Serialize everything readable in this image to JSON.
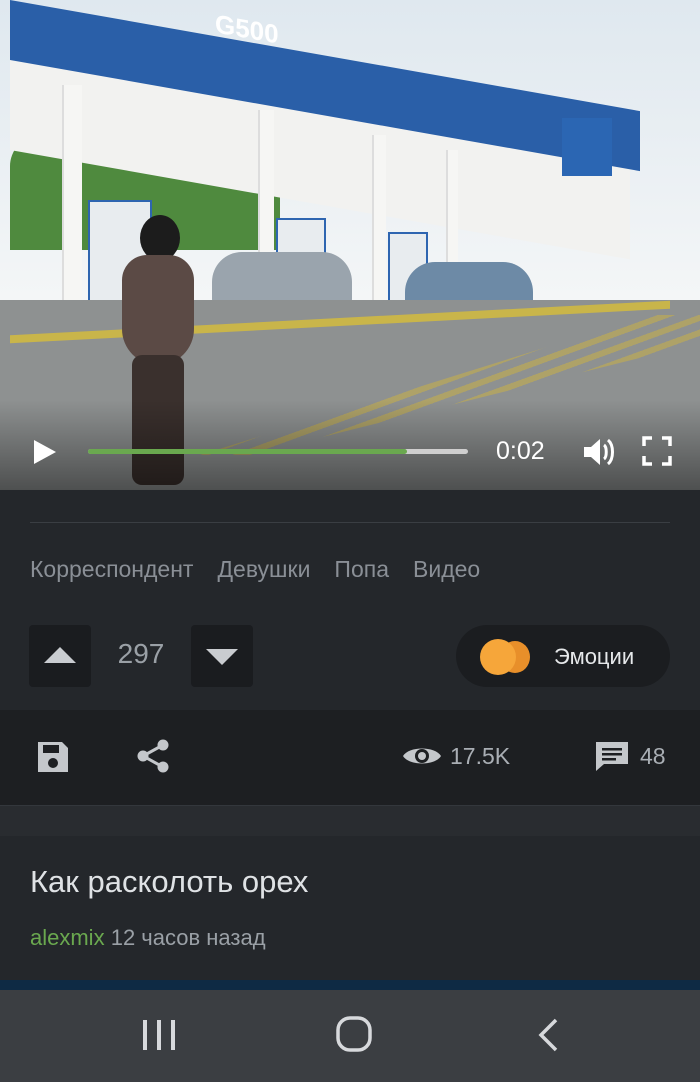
{
  "video": {
    "time": "0:02",
    "progress": 0.84,
    "sign_text": "G500",
    "colors": {
      "progress": "#6aa84f"
    }
  },
  "tags": [
    "Корреспондент",
    "Девушки",
    "Попа",
    "Видео"
  ],
  "vote": {
    "score": "297"
  },
  "emotions": {
    "label": "Эмоции"
  },
  "actions": {
    "save_icon": "save-icon",
    "share_icon": "share-icon",
    "views": "17.5K",
    "comments": "48"
  },
  "next_post": {
    "title": "Как расколоть орех",
    "author": "alexmix",
    "time_ago": "12 часов назад"
  },
  "colors": {
    "background": "#24272b",
    "accent": "#6aa84f",
    "panel": "#1d1f22"
  }
}
